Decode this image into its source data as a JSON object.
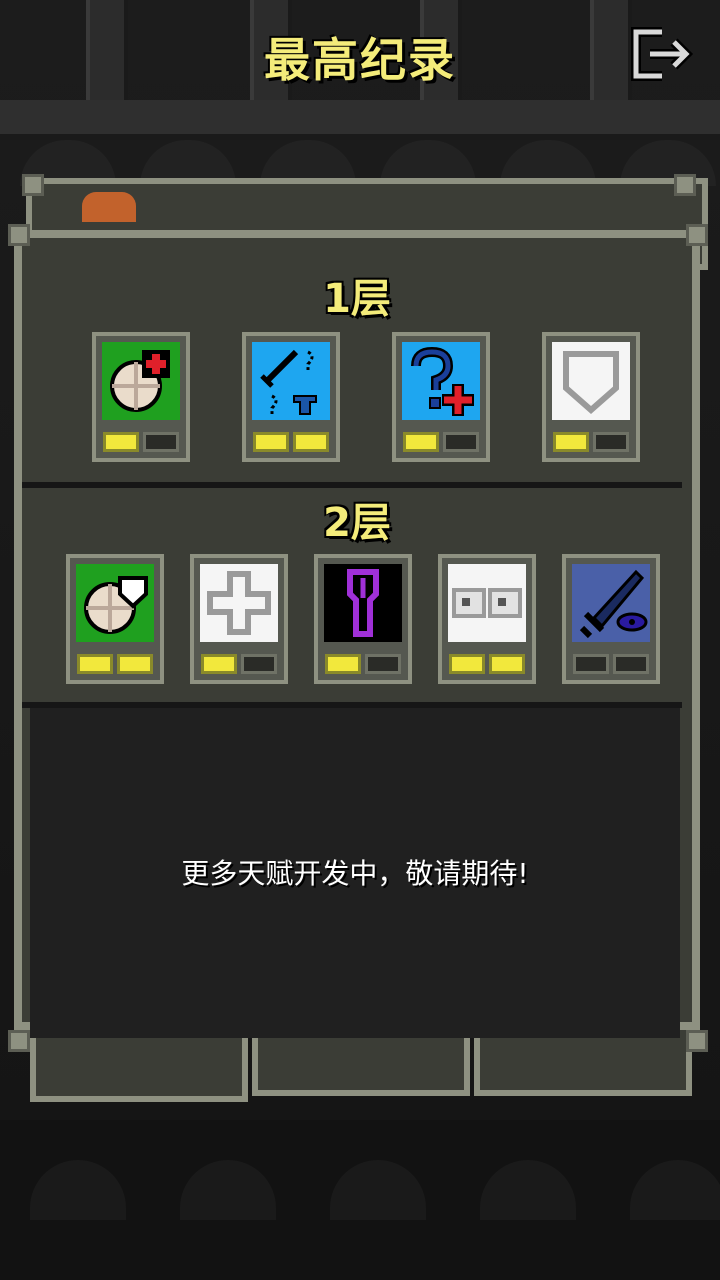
{
  "header": {
    "title": "最高纪录"
  },
  "tiers": [
    {
      "label": "1层",
      "talents": [
        {
          "icon": "hunger-heal-icon",
          "bg": "#1fa01f",
          "levels": [
            true,
            false
          ]
        },
        {
          "icon": "identify-sword-armor-icon",
          "bg": "#1ea6f0",
          "levels": [
            true,
            true
          ]
        },
        {
          "icon": "unknown-heal-icon",
          "bg": "#1ea6f0",
          "levels": [
            true,
            false
          ]
        },
        {
          "icon": "shield-icon",
          "bg": "#f5f5f5",
          "levels": [
            true,
            false
          ]
        }
      ]
    },
    {
      "label": "2层",
      "talents": [
        {
          "icon": "hunger-shield-icon",
          "bg": "#1fa01f",
          "levels": [
            true,
            true
          ]
        },
        {
          "icon": "cross-icon",
          "bg": "#f5f5f5",
          "levels": [
            true,
            false
          ]
        },
        {
          "icon": "key-icon",
          "bg": "#000000",
          "levels": [
            true,
            false
          ]
        },
        {
          "icon": "eyes-icon",
          "bg": "#f5f5f5",
          "levels": [
            true,
            true
          ]
        },
        {
          "icon": "dagger-eye-icon",
          "bg": "#4a60a8",
          "levels": [
            false,
            false
          ]
        }
      ]
    }
  ],
  "message": "更多天赋开发中，敬请期待!",
  "colors": {
    "title": "#f4ec7a",
    "pip_on": "#f2e83c",
    "panel": "#3b3d36",
    "frame": "#8e9181"
  }
}
